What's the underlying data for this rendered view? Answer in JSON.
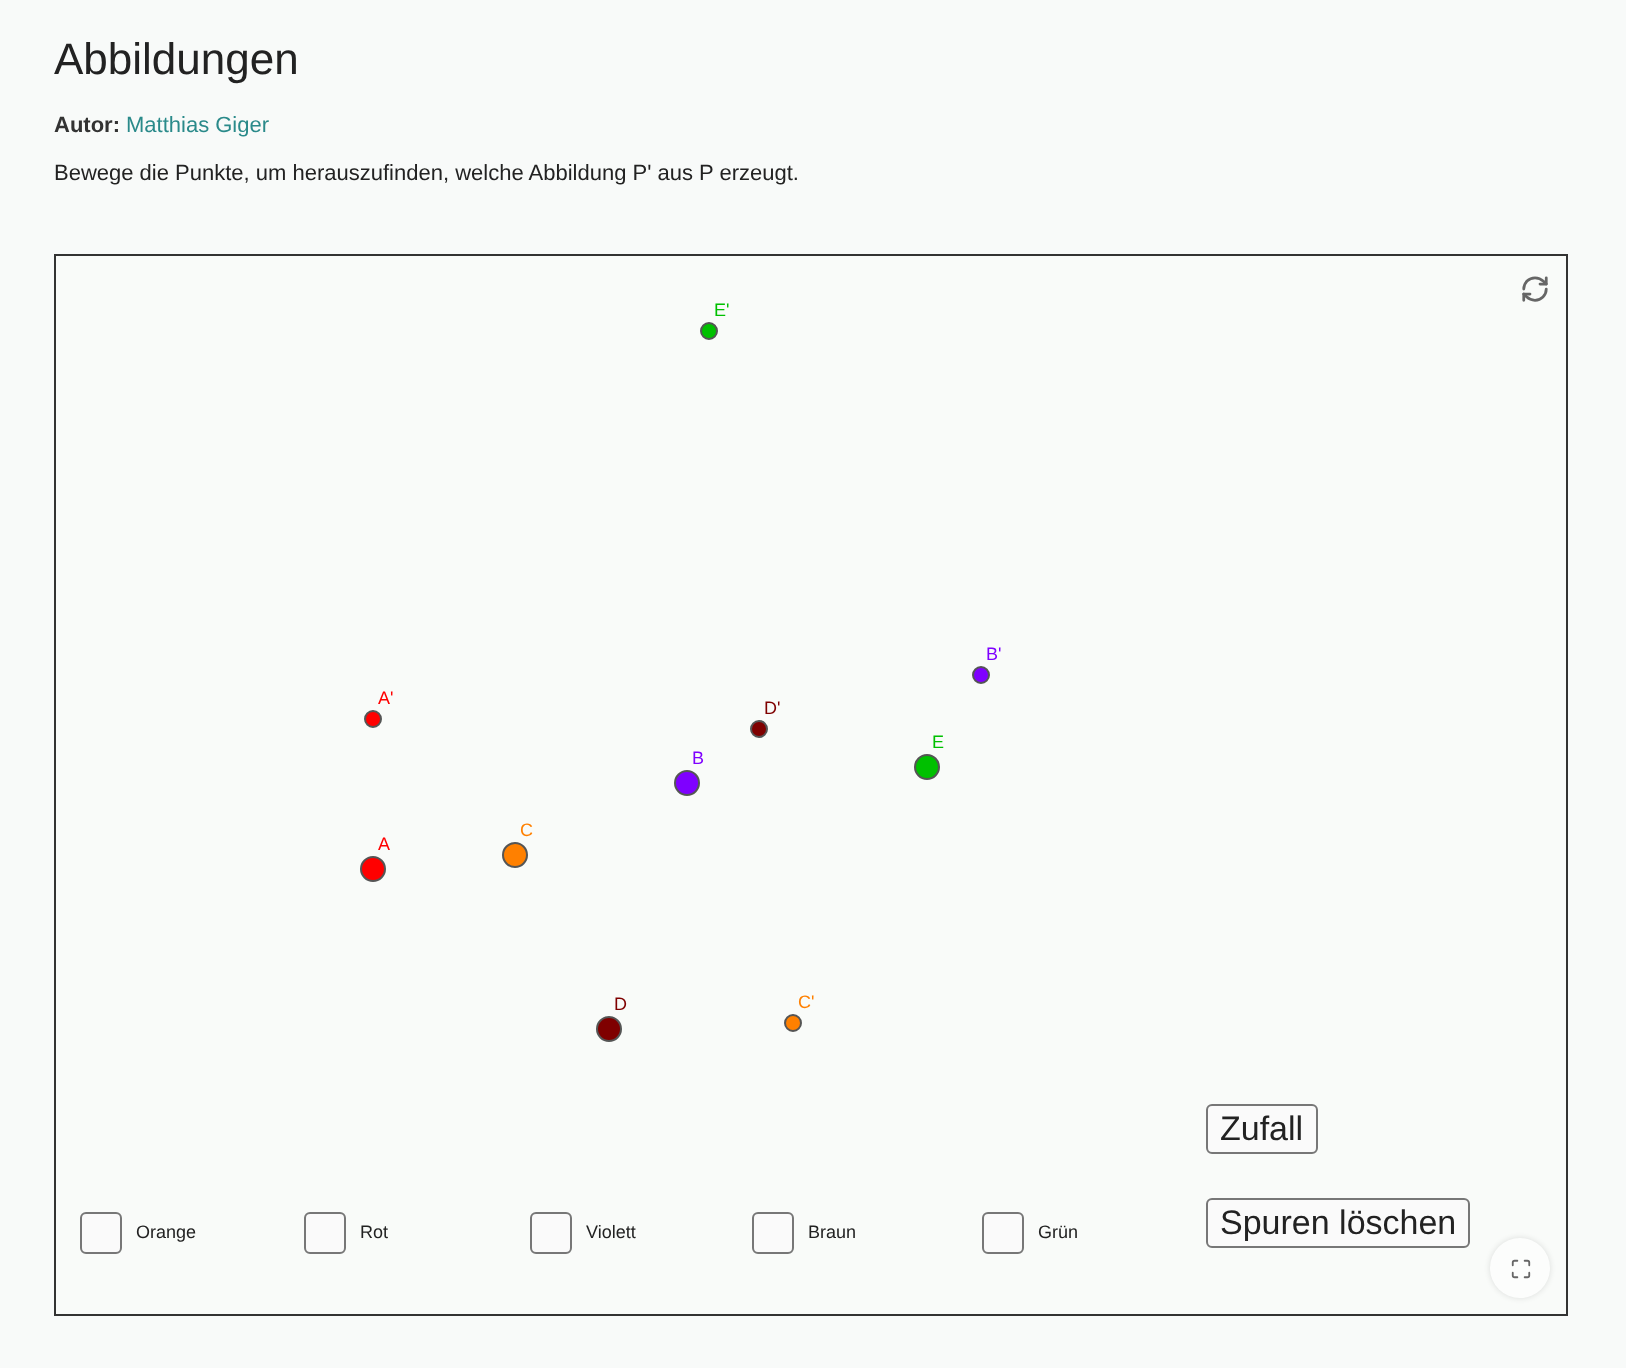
{
  "page": {
    "title": "Abbildungen",
    "author_label": "Autor:",
    "author": "Matthias Giger",
    "description": "Bewege die Punkte, um herauszufinden, welche Abbildung P' aus P erzeugt."
  },
  "applet": {
    "points": [
      {
        "label": "E'",
        "kind": "image",
        "color": "#00c000"
      },
      {
        "label": "B'",
        "kind": "image",
        "color": "#7f00ff"
      },
      {
        "label": "A'",
        "kind": "image",
        "color": "#ff0000"
      },
      {
        "label": "D'",
        "kind": "image",
        "color": "#7f0000"
      },
      {
        "label": "B",
        "kind": "original",
        "color": "#7f00ff"
      },
      {
        "label": "E",
        "kind": "original",
        "color": "#00c000"
      },
      {
        "label": "C",
        "kind": "original",
        "color": "#ff8000"
      },
      {
        "label": "A",
        "kind": "original",
        "color": "#ff0000"
      },
      {
        "label": "D",
        "kind": "original",
        "color": "#7f0000"
      },
      {
        "label": "C'",
        "kind": "image",
        "color": "#ff8000"
      }
    ],
    "checkboxes": [
      {
        "label": "Orange",
        "checked": false
      },
      {
        "label": "Rot",
        "checked": false
      },
      {
        "label": "Violett",
        "checked": false
      },
      {
        "label": "Braun",
        "checked": false
      },
      {
        "label": "Grün",
        "checked": false
      }
    ],
    "buttons": [
      "Zufall",
      "Spuren löschen"
    ]
  }
}
